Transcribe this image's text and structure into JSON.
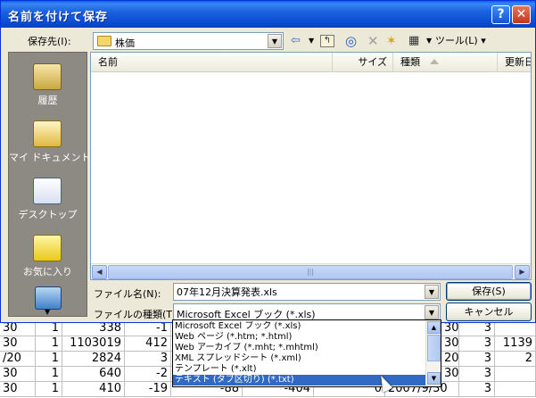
{
  "dialog": {
    "title": "名前を付けて保存",
    "help_glyph": "?",
    "close_glyph": "✕"
  },
  "savein": {
    "label": "保存先(I):",
    "value": "株価"
  },
  "toolbar": {
    "back_glyph": "⇦",
    "up_glyph": "↰",
    "search_glyph": "◎",
    "delete_glyph": "✕",
    "newfolder_glyph": "✶",
    "views_glyph": "▦",
    "tools_label": "ツール(L) ▾"
  },
  "places": [
    {
      "label": "履歴"
    },
    {
      "label": "マイ ドキュメント"
    },
    {
      "label": "デスクトップ"
    },
    {
      "label": "お気に入り"
    }
  ],
  "filelist": {
    "columns": [
      "名前",
      "サイズ",
      "種類",
      "更新日時"
    ]
  },
  "filename": {
    "label": "ファイル名(N):",
    "value": "07年12月決算発表.xls"
  },
  "filetype": {
    "label": "ファイルの種類(T):",
    "value": "Microsoft Excel ブック (*.xls)",
    "options": [
      "Microsoft Excel ブック (*.xls)",
      "Web ページ (*.htm; *.html)",
      "Web アーカイブ (*.mht; *.mhtml)",
      "XML スプレッドシート (*.xml)",
      "テンプレート (*.xlt)",
      "テキスト (タブ区切り) (*.txt)"
    ],
    "selected_index": 5
  },
  "buttons": {
    "save": "保存(S)",
    "cancel": "キャンセル"
  },
  "sheet": {
    "rows": [
      [
        "30",
        "1",
        "338",
        "-1",
        "",
        "",
        "",
        "30",
        "3",
        ""
      ],
      [
        "30",
        "1",
        "1103019",
        "412",
        "",
        "",
        "",
        "30",
        "3",
        "1139"
      ],
      [
        "/20",
        "1",
        "2824",
        "3",
        "",
        "",
        "",
        "20",
        "3",
        "2"
      ],
      [
        "30",
        "1",
        "640",
        "-2",
        "",
        "",
        "",
        "30",
        "3",
        ""
      ],
      [
        "30",
        "1",
        "410",
        "-19",
        "-88",
        "-404",
        "0",
        "2007/9/30",
        "3",
        ""
      ]
    ]
  },
  "colors": {
    "titlebar": "#0a49d0",
    "dialog_bg": "#ece9d8",
    "places_bg": "#8c8a82",
    "selection": "#316ac5"
  }
}
